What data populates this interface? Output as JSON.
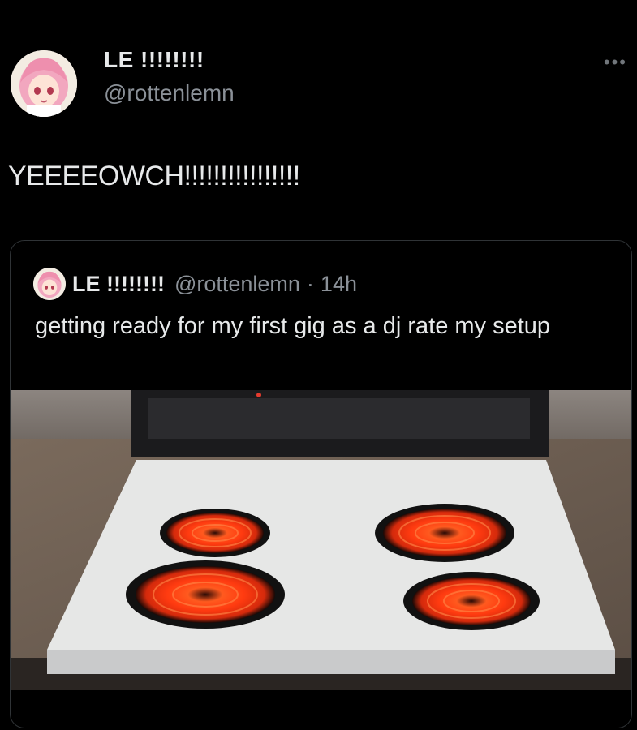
{
  "tweet": {
    "display_name": "LE !!!!!!!!",
    "handle": "@rottenlemn",
    "more_icon": "more-horizontal-icon",
    "text": "YEEEEOWCH!!!!!!!!!!!!!!!!"
  },
  "quote": {
    "display_name": "LE !!!!!!!!",
    "handle": "@rottenlemn",
    "separator": "·",
    "time": "14h",
    "text": "getting ready for my first gig as a dj rate my setup"
  },
  "colors": {
    "background": "#000000",
    "text_primary": "#e7e9ea",
    "text_secondary": "#8b9198",
    "border": "#2f3336",
    "burner_glow": "#ff4a1a"
  }
}
